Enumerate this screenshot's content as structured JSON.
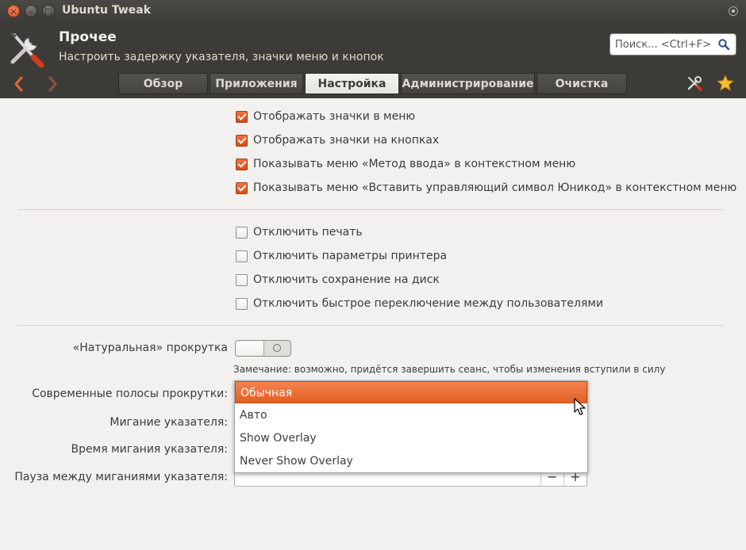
{
  "window": {
    "title": "Ubuntu Tweak",
    "close_glyph": "×",
    "min_glyph": "–",
    "max_glyph": "□"
  },
  "header": {
    "title": "Прочее",
    "subtitle": "Настроить задержку указателя, значки меню и кнопок",
    "search_placeholder": "Поиск... <Ctrl+F>",
    "tabs": [
      {
        "label": "Обзор",
        "active": false
      },
      {
        "label": "Приложения",
        "active": false
      },
      {
        "label": "Настройка",
        "active": true
      },
      {
        "label": "Администрирование",
        "active": false
      },
      {
        "label": "Очистка",
        "active": false
      }
    ]
  },
  "checks_group1": [
    {
      "label": "Отображать значки в меню",
      "checked": true
    },
    {
      "label": "Отображать значки на кнопках",
      "checked": true
    },
    {
      "label": "Показывать меню «Метод ввода» в контекстном меню",
      "checked": true
    },
    {
      "label": "Показывать меню «Вставить управляющий символ Юникод» в контекстном меню",
      "checked": true
    }
  ],
  "checks_group2": [
    {
      "label": "Отключить печать",
      "checked": false
    },
    {
      "label": "Отключить параметры принтера",
      "checked": false
    },
    {
      "label": "Отключить сохранение на диск",
      "checked": false
    },
    {
      "label": "Отключить быстрое переключение между пользователями",
      "checked": false
    }
  ],
  "settings": {
    "natural_scroll_label": "«Натуральная» прокрутка",
    "note": "Замечание: возможно, придётся завершить сеанс, чтобы изменения вступили в силу",
    "scrollbars_label": "Современные полосы прокрутки:",
    "cursor_blink_label": "Мигание указателя:",
    "cursor_blink_time_label": "Время мигания указателя:",
    "cursor_pause_label": "Пауза между миганиями указателя:",
    "spin_minus": "−",
    "spin_plus": "+"
  },
  "dropdown": {
    "options": [
      "Обычная",
      "Авто",
      "Show Overlay",
      "Never Show Overlay"
    ],
    "selected_index": 0
  },
  "colors": {
    "accent": "#e25f22",
    "header_bg": "#3c3b37",
    "window_bg": "#f2f1f0"
  }
}
